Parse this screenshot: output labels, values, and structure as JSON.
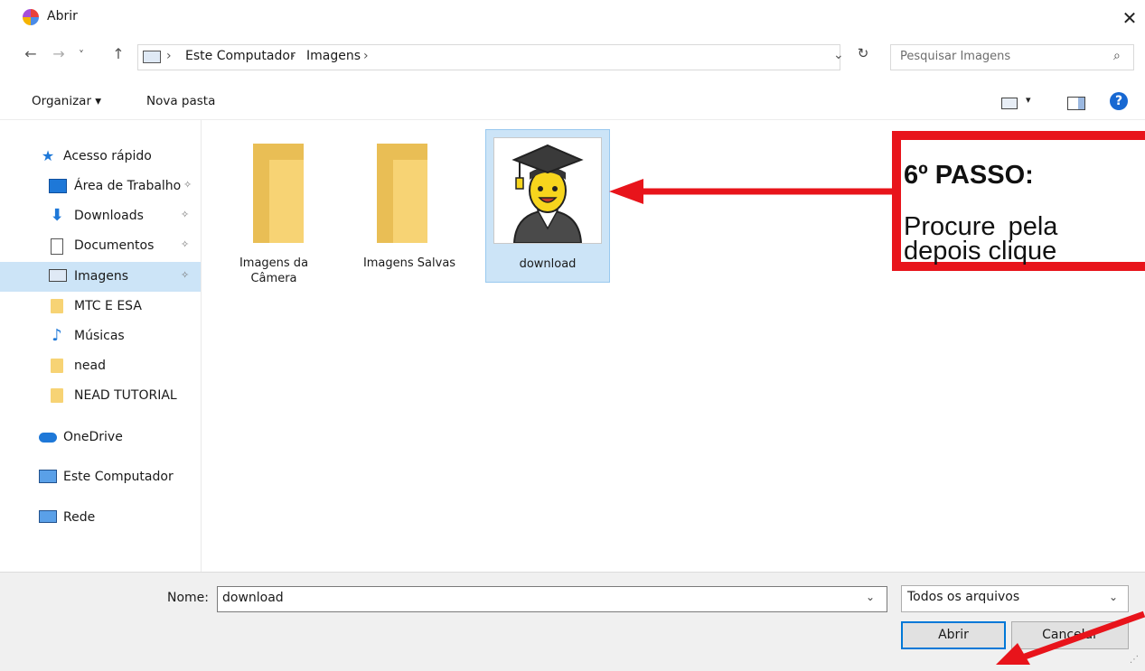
{
  "window": {
    "title": "Abrir",
    "close_glyph": "✕"
  },
  "nav": {
    "back": "←",
    "forward": "→",
    "recent": "˅",
    "up": "↑",
    "refresh": "↻",
    "addr_drop": "⌄"
  },
  "address": {
    "crumbs": [
      "Este Computador",
      "Imagens"
    ],
    "sep": "›"
  },
  "search": {
    "placeholder": "Pesquisar Imagens",
    "icon": "⌕"
  },
  "toolbar": {
    "organize": "Organizar ▾",
    "new_folder": "Nova pasta",
    "view_arrow": "▾",
    "help": "?"
  },
  "sidebar": {
    "items": [
      {
        "label": "Acesso rápido",
        "icon": "star-icon"
      },
      {
        "label": "Área de Trabalho",
        "icon": "desktop-icon",
        "pinned": true
      },
      {
        "label": "Downloads",
        "icon": "download-icon",
        "pinned": true
      },
      {
        "label": "Documentos",
        "icon": "document-icon",
        "pinned": true
      },
      {
        "label": "Imagens",
        "icon": "pictures-icon",
        "pinned": true,
        "selected": true
      },
      {
        "label": "MTC E ESA",
        "icon": "folder-icon"
      },
      {
        "label": "Músicas",
        "icon": "music-icon"
      },
      {
        "label": "nead",
        "icon": "folder-icon"
      },
      {
        "label": "NEAD TUTORIAL",
        "icon": "folder-icon"
      },
      {
        "label": "OneDrive",
        "icon": "cloud-icon"
      },
      {
        "label": "Este Computador",
        "icon": "computer-icon"
      },
      {
        "label": "Rede",
        "icon": "network-icon"
      }
    ],
    "pin_glyph": "📌"
  },
  "files": [
    {
      "label_lines": [
        "Imagens da",
        "Câmera"
      ],
      "type": "folder"
    },
    {
      "label_lines": [
        "Imagens Salvas"
      ],
      "type": "folder"
    },
    {
      "label_lines": [
        "download"
      ],
      "type": "image",
      "selected": true
    }
  ],
  "bottom": {
    "name_label": "Nome:",
    "name_value": "download",
    "type_value": "Todos os arquivos",
    "drop_glyph": "⌄",
    "open_button": "Abrir",
    "cancel_button": "Cancelar",
    "grip": "⋰"
  },
  "annotation": {
    "title": "6º PASSO:",
    "lines": [
      "Procure  pela",
      "depois clique"
    ],
    "color": "#e8141b"
  },
  "colors": {
    "selection": "#cce4f7",
    "accent": "#0078d7",
    "annotation_red": "#e8141b"
  }
}
